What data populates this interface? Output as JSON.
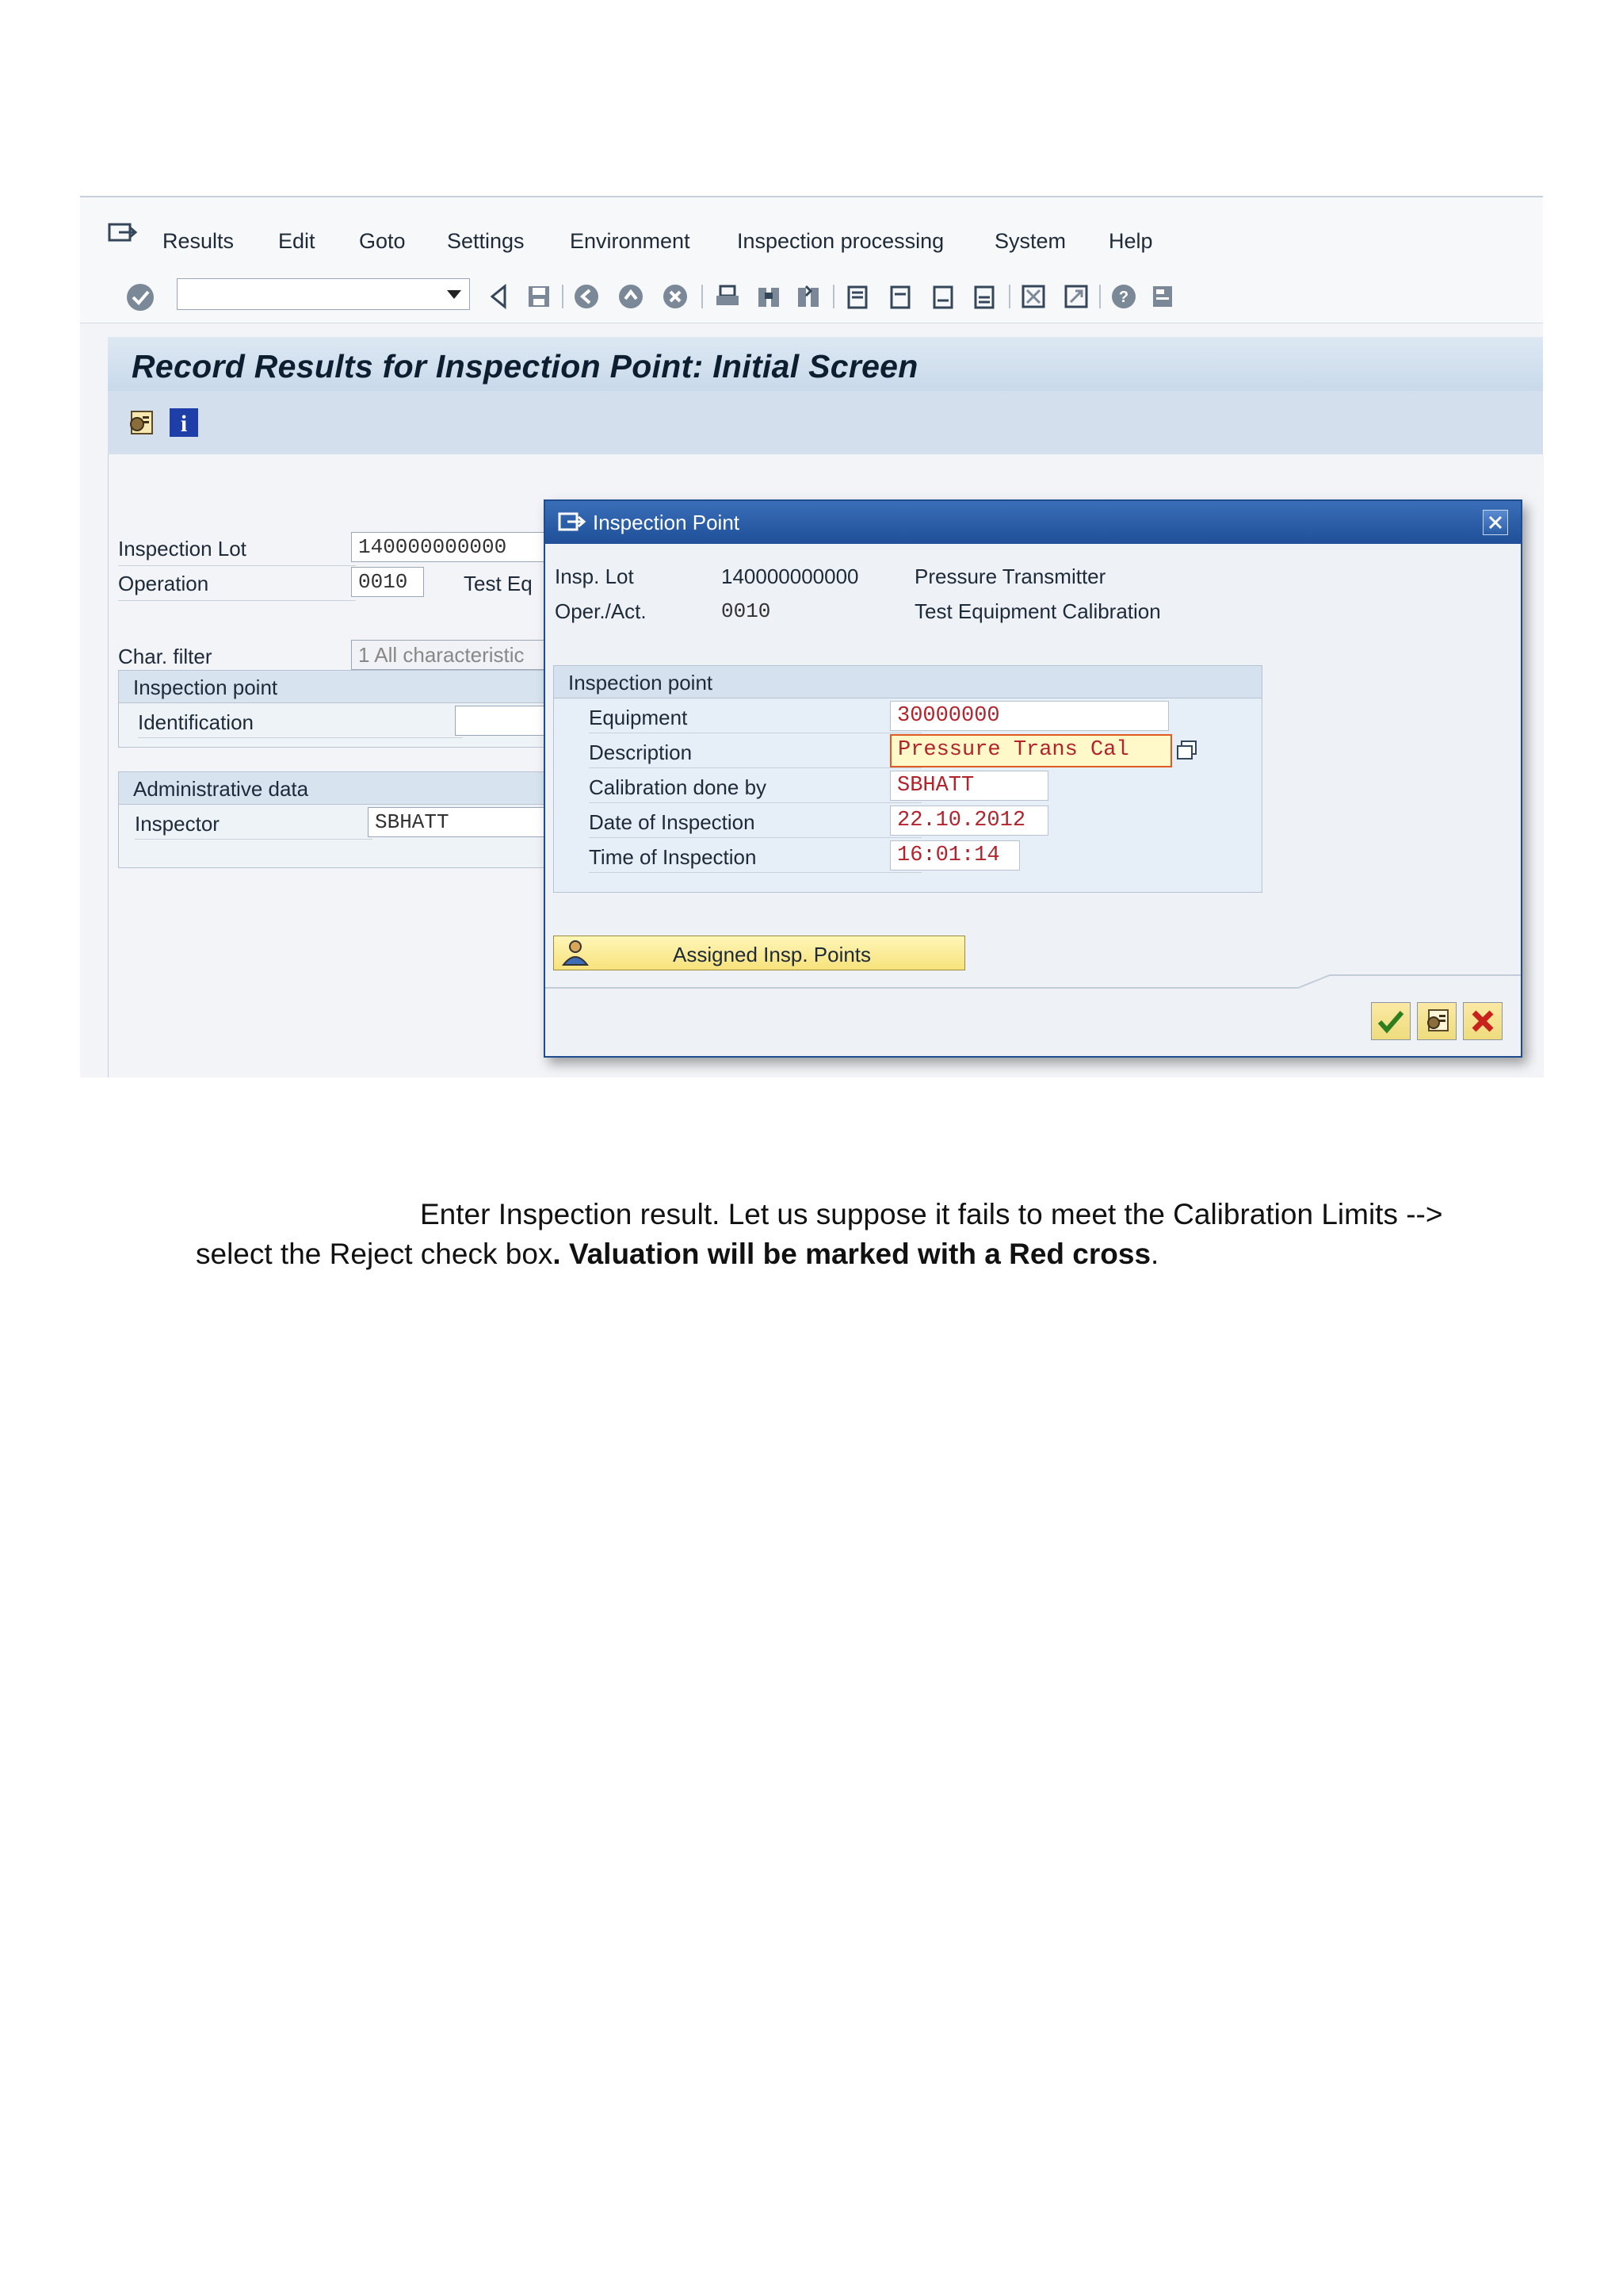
{
  "menubar": {
    "items": [
      "Results",
      "Edit",
      "Goto",
      "Settings",
      "Environment",
      "Inspection processing",
      "System",
      "Help"
    ]
  },
  "page": {
    "title": "Record Results for Inspection Point: Initial Screen"
  },
  "form": {
    "inspection_lot_label": "Inspection Lot",
    "inspection_lot_value": "140000000000",
    "operation_label": "Operation",
    "operation_value": "0010",
    "operation_desc": "Test Eq",
    "char_filter_label": "Char. filter",
    "char_filter_value": "1 All characteristic",
    "inspection_point_group": "Inspection point",
    "identification_label": "Identification",
    "admin_group": "Administrative data",
    "inspector_label": "Inspector",
    "inspector_value": "SBHATT"
  },
  "dialog": {
    "title": "Inspection Point",
    "insp_lot_label": "Insp. Lot",
    "insp_lot_value": "140000000000",
    "insp_lot_desc": "Pressure Transmitter",
    "oper_label": "Oper./Act.",
    "oper_value": "0010",
    "oper_desc": "Test Equipment Calibration",
    "group_title": "Inspection point",
    "fields": [
      {
        "label": "Equipment",
        "value": "30000000"
      },
      {
        "label": "Description",
        "value": "Pressure Trans Cal"
      },
      {
        "label": "Calibration done by",
        "value": "SBHATT"
      },
      {
        "label": "Date of Inspection",
        "value": "22.10.2012"
      },
      {
        "label": "Time of Inspection",
        "value": "16:01:14"
      }
    ],
    "assigned_button": "Assigned Insp. Points"
  },
  "instructions": {
    "line1": "Enter Inspection result. Let us suppose it fails to meet the Calibration Limits -->",
    "line2_start": "select the Reject check box",
    "line2_bold": ". Valuation will be marked with a Red cross",
    "line2_end": "."
  },
  "colors": {
    "dialog_title": "#1f4f99",
    "field_value": "#b3232b",
    "button_yellow": "#f7e27c"
  }
}
